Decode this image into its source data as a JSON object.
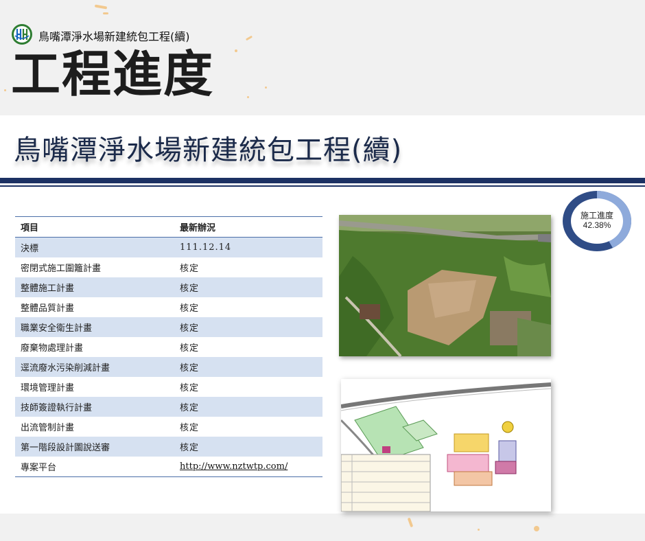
{
  "header": {
    "project_name": "鳥嘴潭淨水場新建統包工程(續)",
    "section_title": "工程進度"
  },
  "slide": {
    "title": "鳥嘴潭淨水場新建統包工程(續)"
  },
  "status_table": {
    "headers": [
      "項目",
      "最新辦況"
    ],
    "rows": [
      {
        "item": "決標",
        "status": "111.12.14"
      },
      {
        "item": "密閉式施工圍籬計畫",
        "status": "核定"
      },
      {
        "item": "整體施工計畫",
        "status": "核定"
      },
      {
        "item": "整體品質計畫",
        "status": "核定"
      },
      {
        "item": "職業安全衛生計畫",
        "status": "核定"
      },
      {
        "item": "廢棄物處理計畫",
        "status": "核定"
      },
      {
        "item": "逕流廢水污染削減計畫",
        "status": "核定"
      },
      {
        "item": "環境管理計畫",
        "status": "核定"
      },
      {
        "item": "技師簽證執行計畫",
        "status": "核定"
      },
      {
        "item": "出流管制計畫",
        "status": "核定"
      },
      {
        "item": "第一階段設計圖說送審",
        "status": "核定"
      },
      {
        "item": "專案平台",
        "status": "http://www.nztwtp.com/"
      }
    ]
  },
  "progress": {
    "label": "施工進度",
    "value_text": "42.38%",
    "fraction": 0.4238
  },
  "colors": {
    "navy": "#1c3163",
    "table_stripe": "#d6e1f1",
    "donut_fill": "#8eaadb",
    "donut_track": "#2f4c86"
  },
  "images": {
    "aerial": "aerial-photo-icon",
    "plan": "site-plan-icon"
  }
}
